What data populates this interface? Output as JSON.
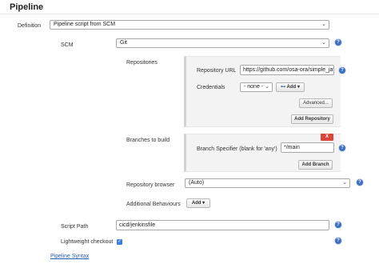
{
  "page": {
    "title": "Pipeline"
  },
  "definition": {
    "label": "Definition",
    "value": "Pipeline script from SCM"
  },
  "scm": {
    "label": "SCM",
    "value": "Git"
  },
  "repositories": {
    "label": "Repositories",
    "repo_url_label": "Repository URL",
    "repo_url_value": "https://github.com/osa-ora/simple_java",
    "credentials_label": "Credentials",
    "credentials_value": "- none -",
    "add_label": "Add",
    "advanced_label": "Advanced...",
    "add_repository_label": "Add Repository"
  },
  "branches": {
    "label": "Branches to build",
    "delete_label": "X",
    "specifier_label": "Branch Specifier (blank for 'any')",
    "specifier_value": "*/main",
    "add_branch_label": "Add Branch"
  },
  "repo_browser": {
    "label": "Repository browser",
    "value": "(Auto)"
  },
  "additional_behaviours": {
    "label": "Additional Behaviours",
    "add_label": "Add"
  },
  "script_path": {
    "label": "Script Path",
    "value": "cicd/jenkinsfile"
  },
  "lightweight_checkout": {
    "label": "Lightweight checkout",
    "checked": true,
    "check_glyph": "✓"
  },
  "pipeline_syntax": {
    "label": "Pipeline Syntax"
  },
  "icons": {
    "help": "?",
    "chevron": "⌄",
    "key": "⊷",
    "caret": "▾"
  },
  "colors": {
    "accent": "#3c6fbf",
    "link": "#2a5db0",
    "danger": "#d9463a",
    "checkbox": "#3b7de1"
  }
}
